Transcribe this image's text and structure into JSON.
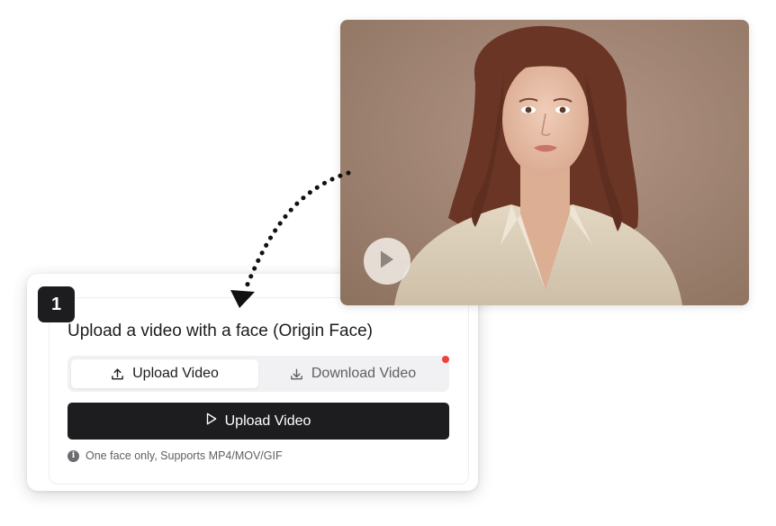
{
  "step": {
    "number": "1"
  },
  "card": {
    "title": "Upload a video with a face (Origin Face)"
  },
  "tabs": [
    {
      "label": "Upload Video",
      "icon": "upload-icon",
      "active": true
    },
    {
      "label": "Download Video",
      "icon": "download-icon",
      "active": false
    }
  ],
  "upload_button": {
    "label": "Upload Video",
    "icon": "play-outline-icon"
  },
  "hint": {
    "text": "One face only, Supports MP4/MOV/GIF",
    "icon": "info-icon"
  },
  "video": {
    "play_icon": "play-icon"
  },
  "colors": {
    "primary_dark": "#1d1d1f",
    "notification_dot": "#f0413f",
    "tab_track": "#f1f1f3",
    "video_background": "#9c7f6d"
  }
}
